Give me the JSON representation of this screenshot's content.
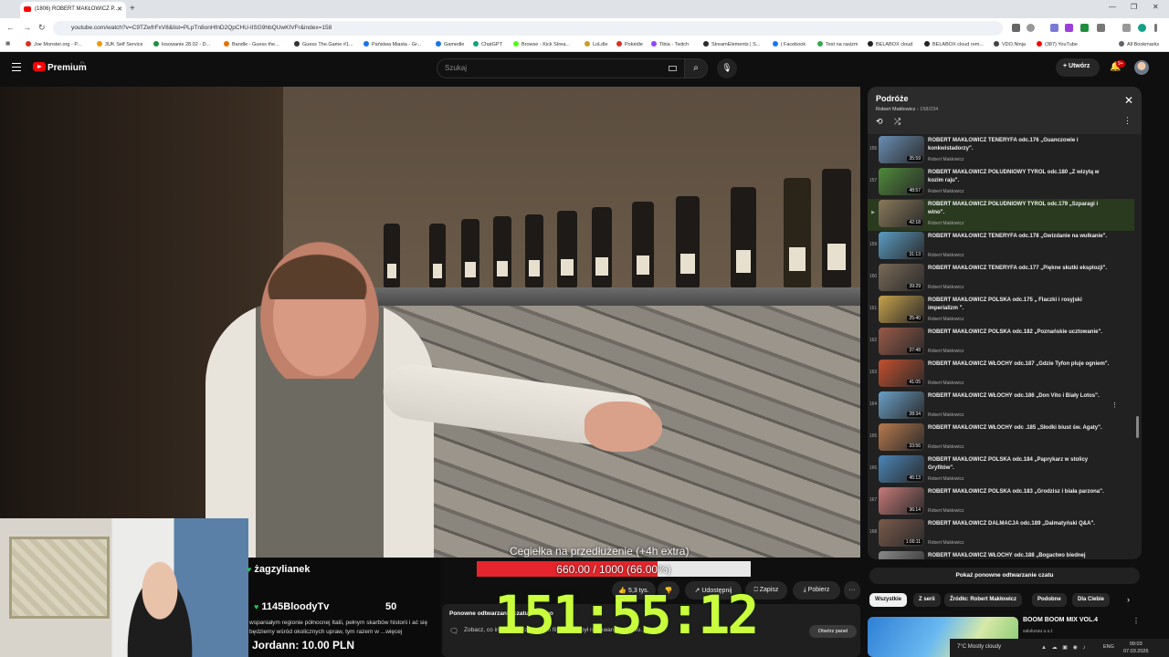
{
  "browser": {
    "tab_title": "(1806) ROBERT MAKŁOWICZ P...",
    "url": "youtube.com/watch?v=C9TZwfrFxV8&list=PLpTn8onHfnD2QpCHU-lISG9hbQUwKIVFr&index=158",
    "bookmarks": [
      "Joe Monster.org - P...",
      "3UK Self Service",
      "losowanie 28.02 - D...",
      "Bandle - Guess the...",
      "Guess The.Game #1...",
      "Państwa Miasta - Gr...",
      "Gamedle",
      "ChatGPT",
      "Browse - Kick Strea...",
      "LoLdle",
      "Pokédle",
      "Tibia - Twitch",
      "StreamElements | S...",
      "| Facebook",
      "Test na rasizm",
      "BELABOX cloud",
      "BELABOX cloud rem...",
      "VDO.Ninja",
      "(387) YouTube",
      "All Bookmarks"
    ],
    "bookmark_colors": [
      "#d93025",
      "#f29900",
      "#1e8e3e",
      "#e37400",
      "#333333",
      "#1a73e8",
      "#1a73e8",
      "#10a37f",
      "#53fc18",
      "#c5a028",
      "#d93025",
      "#9146ff",
      "#2b2b2b",
      "#1877f2",
      "#34a853",
      "#222222",
      "#222222",
      "#444444",
      "#ff0000",
      "#5f6368"
    ]
  },
  "youtube": {
    "brand": "Premium",
    "country_code": "PL",
    "search_placeholder": "Szukaj",
    "create_label": "Utwórz",
    "notif_count": "9+"
  },
  "overlay": {
    "caption": "Cegiełka na przedłużenie (+4h extra)",
    "progress_text": "660.00 / 1000 (66.00%)",
    "progress_fraction": 0.66,
    "timer": "151:55:12",
    "chat_user1": "żagzylianek",
    "chat_user2": "1145BloodyTv",
    "chat_count": "50",
    "donation": "Jordann: 10.00 PLN",
    "description": "wspaniałym regionie północnej Italii, pełnym skarbów historii i ać się będziemy wśród okolicznych upraw, tym razem w ...więcej"
  },
  "actions": {
    "likes": "5,3 tys.",
    "share": "Udostępnij",
    "save": "Zapisz",
    "download": "Pobierz"
  },
  "live_chat": {
    "title": "Ponowne odtwarzanie czatu na żywo",
    "subtitle": "Zobacz, co inni powiedzieli o tym filmie, gdy był nadawany na żywo.",
    "button": "Otwórz panel"
  },
  "playlist": {
    "title": "Podróże",
    "channel": "Robert Makłowicz",
    "position": "158/234",
    "items": [
      {
        "num": "156",
        "title": "ROBERT MAKŁOWICZ TENERYFA odc.176 „Guanczowie i konkwistadorzy\".",
        "channel": "Robert Makłowicz",
        "duration": "35:59",
        "active": false,
        "thumb": "#6a8fb5"
      },
      {
        "num": "157",
        "title": "ROBERT MAKŁOWICZ POŁUDNIOWY TYROL odc.180 „Z wizytą w kozim raju\".",
        "channel": "Robert Makłowicz",
        "duration": "48:57",
        "active": false,
        "thumb": "#4f8a3a"
      },
      {
        "num": "▶",
        "title": "ROBERT MAKŁOWICZ POŁUDNIOWY TYROL odc.179 „Szparagi i wino\".",
        "channel": "Robert Makłowicz",
        "duration": "42:18",
        "active": true,
        "thumb": "#8a7a5a"
      },
      {
        "num": "159",
        "title": "ROBERT MAKŁOWICZ TENERYFA odc.178 „Gwizdanie na wulkanie\".",
        "channel": "Robert Makłowicz",
        "duration": "31:13",
        "active": false,
        "thumb": "#5b9cc4"
      },
      {
        "num": "160",
        "title": "ROBERT MAKŁOWICZ TENERYFA odc.177 „Piękne skutki eksplozji\".",
        "channel": "Robert Makłowicz",
        "duration": "39:29",
        "active": false,
        "thumb": "#7a6a58"
      },
      {
        "num": "161",
        "title": "ROBERT MAKŁOWICZ POLSKA odc.175 „ Flaczki i rosyjski imperializm \".",
        "channel": "Robert Makłowicz",
        "duration": "25:40",
        "active": false,
        "thumb": "#c8a24a"
      },
      {
        "num": "162",
        "title": "ROBERT MAKŁOWICZ POLSKA odc.182 „Poznańskie ucztowanie\".",
        "channel": "Robert Makłowicz",
        "duration": "37:48",
        "active": false,
        "thumb": "#9a5a48"
      },
      {
        "num": "163",
        "title": "ROBERT MAKŁOWICZ WŁOCHY odc.187 „Gdzie Tyfon pluje ogniem\".",
        "channel": "Robert Makłowicz",
        "duration": "41:05",
        "active": false,
        "thumb": "#c4502e"
      },
      {
        "num": "164",
        "title": "ROBERT MAKŁOWICZ WŁOCHY odc.186 „Don Vito i Biały Lotos\".",
        "channel": "Robert Makłowicz",
        "duration": "28:34",
        "active": false,
        "thumb": "#6aa0c8"
      },
      {
        "num": "165",
        "title": "ROBERT MAKŁOWICZ WŁOCHY odc .185 „Słodki biust św. Agaty\".",
        "channel": "Robert Makłowicz",
        "duration": "33:56",
        "active": false,
        "thumb": "#b87a4e"
      },
      {
        "num": "166",
        "title": "ROBERT MAKŁOWICZ POLSKA odc.184 „Paprykarz w stolicy Gryfitów\".",
        "channel": "Robert Makłowicz",
        "duration": "45:13",
        "active": false,
        "thumb": "#4a86b8"
      },
      {
        "num": "167",
        "title": "ROBERT MAKŁOWICZ POLSKA odc.183 „Grodzisz i biała parzona\".",
        "channel": "Robert Makłowicz",
        "duration": "36:14",
        "active": false,
        "thumb": "#c87a7a"
      },
      {
        "num": "168",
        "title": "ROBERT MAKŁOWICZ DALMACJA odc.189 „Dalmatyński Q&A\".",
        "channel": "Robert Makłowicz",
        "duration": "1:00:11",
        "active": false,
        "thumb": "#7a5a4a"
      },
      {
        "num": "169",
        "title": "ROBERT MAKŁOWICZ WŁOCHY odc.188 „Bogactwo biednej",
        "channel": "",
        "duration": "",
        "active": false,
        "thumb": "#8a8a8a"
      }
    ]
  },
  "replay_button": "Pokaż ponowne odtwarzanie czatu",
  "chips": [
    "Wszystkie",
    "Z serii",
    "Źródło: Robert Makłowicz",
    "Podobne",
    "Dla Ciebie"
  ],
  "recommended": {
    "title": "BOOM BOOM MIX VOL.4",
    "channel": "salulusuu u.u.t"
  },
  "taskbar": {
    "weather": "7°C  Mostly cloudy",
    "lang": "ENG",
    "time": "09:03",
    "date": "07.03.2026"
  }
}
